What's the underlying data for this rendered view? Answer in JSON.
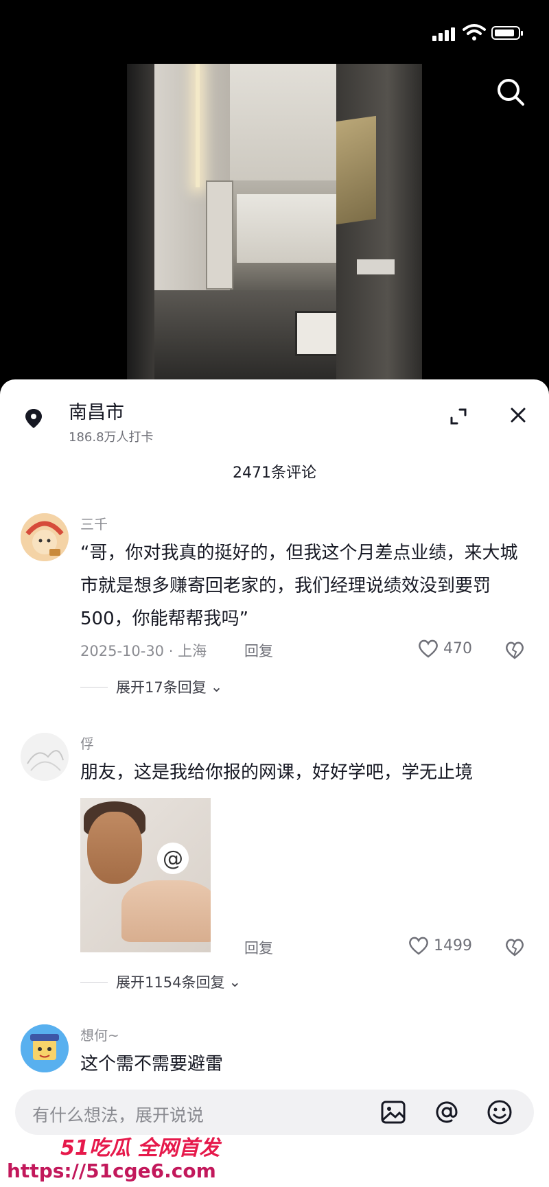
{
  "location": {
    "name": "南昌市",
    "checkins": "186.8万人打卡"
  },
  "comments_count": "2471条评论",
  "comments": [
    {
      "user": "三千",
      "text": "“哥，你对我真的挺好的，但我这个月差点业绩，来大城市就是想多赚寄回老家的，我们经理说绩效没到要罚500，你能帮帮我吗”",
      "meta": "2025-10-30 · 上海",
      "reply": "回复",
      "likes": "470",
      "expand": "展开17条回复"
    },
    {
      "user": "俘",
      "text": "朋友，这是我给你报的网课，好好学吧，学无止境",
      "reply": "回复",
      "likes": "1499",
      "expand": "展开1154条回复"
    },
    {
      "user": "想何~",
      "text": "这个需不需要避雷"
    }
  ],
  "input": {
    "placeholder": "有什么想法，展开说说"
  },
  "watermark": {
    "line1": "51吃瓜 全网首发",
    "line2": "https://51cge6.com"
  },
  "icons": [
    "signal-icon",
    "wifi-icon",
    "battery-icon",
    "search-icon",
    "location-pin-icon",
    "expand-icon",
    "close-icon",
    "heart-icon",
    "broken-heart-icon",
    "image-icon",
    "at-icon",
    "emoji-icon"
  ]
}
